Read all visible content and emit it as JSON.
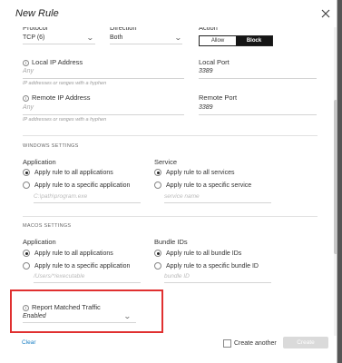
{
  "dialog": {
    "title": "New Rule",
    "close_icon": "close-icon"
  },
  "protocol": {
    "label": "Protocol",
    "value": "TCP (6)"
  },
  "direction": {
    "label": "Direction",
    "value": "Both"
  },
  "action": {
    "label": "Action",
    "options": [
      "Allow",
      "Block"
    ],
    "selected": "Block"
  },
  "local_ip": {
    "label": "Local IP Address",
    "placeholder": "Any",
    "hint": "IP addresses or ranges with a hyphen"
  },
  "local_port": {
    "label": "Local Port",
    "value": "3389"
  },
  "remote_ip": {
    "label": "Remote IP Address",
    "placeholder": "Any",
    "hint": "IP addresses or ranges with a hyphen"
  },
  "remote_port": {
    "label": "Remote Port",
    "value": "3389"
  },
  "windows": {
    "heading": "WINDOWS SETTINGS",
    "application": {
      "label": "Application",
      "options": [
        "Apply rule to all applications",
        "Apply rule to a specific application"
      ],
      "selected_index": 0,
      "placeholder": "C:\\path\\program.exe"
    },
    "service": {
      "label": "Service",
      "options": [
        "Apply rule to all services",
        "Apply rule to a specific service"
      ],
      "selected_index": 0,
      "placeholder": "service name"
    }
  },
  "macos": {
    "heading": "MACOS SETTINGS",
    "application": {
      "label": "Application",
      "options": [
        "Apply rule to all applications",
        "Apply rule to a specific application"
      ],
      "selected_index": 0,
      "placeholder": "/Users/*/executable"
    },
    "bundle": {
      "label": "Bundle IDs",
      "options": [
        "Apply rule to all bundle IDs",
        "Apply rule to a specific bundle ID"
      ],
      "selected_index": 0,
      "placeholder": "bundle ID"
    }
  },
  "report": {
    "label": "Report Matched Traffic",
    "value": "Enabled"
  },
  "footer": {
    "clear_label": "Clear",
    "create_another_label": "Create another",
    "create_label": "Create"
  },
  "colors": {
    "highlight": "#e03030",
    "link": "#1a7fc4",
    "toggle_active": "#151515"
  }
}
